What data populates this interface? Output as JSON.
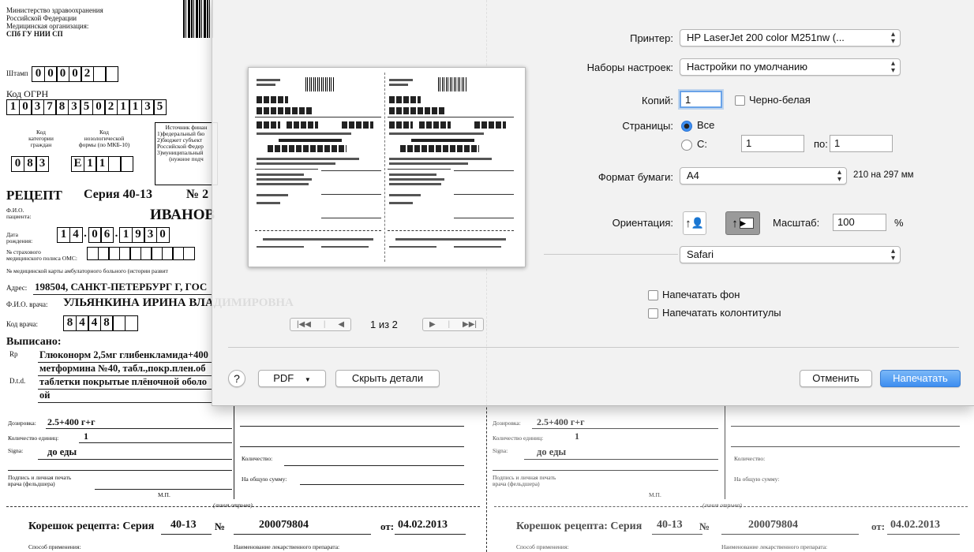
{
  "doc": {
    "ministry": [
      "Министерство здравоохранения",
      "Российской Федерации",
      "Медицинская организация:",
      "СПб ГУ НИИ СП"
    ],
    "stamp_label": "Штамп",
    "stamp_digits": [
      "0",
      "0",
      "0",
      "0",
      "2",
      "",
      ""
    ],
    "ogrn_label": "Код ОГРН",
    "ogrn_digits": [
      "1",
      "0",
      "3",
      "7",
      "8",
      "3",
      "5",
      "0",
      "2",
      "1",
      "1",
      "3",
      "5"
    ],
    "source_lines": [
      "Источник финан",
      "1)федеральный бю",
      "2)бюджет субъект",
      "Российской Федер",
      "3)муниципальный",
      "(нужное подч"
    ],
    "cat_label": [
      "Код",
      "категории",
      "граждан"
    ],
    "cat_digits": [
      "0",
      "8",
      "3"
    ],
    "nos_label": [
      "Код",
      "нозологической",
      "формы (по МКБ-10)"
    ],
    "nos_digits": [
      "Е",
      "1",
      "1",
      "",
      ""
    ],
    "recipe_title": "РЕЦЕПТ",
    "series_label": "Серия 40-13",
    "number_label": "№ 2",
    "fio_label": [
      "Ф.И.О.",
      "пациента:"
    ],
    "patient_name": "ИВАНОВ",
    "dob_label": [
      "Дата",
      "рождения:"
    ],
    "dob_digits": [
      "1",
      "4",
      ".",
      "0",
      "6",
      ".",
      "1",
      "9",
      "3",
      "0"
    ],
    "polis_label": [
      "№ страхового",
      "медицинского полиса ОМС:"
    ],
    "card_label": "№ медицинской карты амбулаторного больного (истории развит",
    "address_label": "Адрес:",
    "address": "198504, САНКТ-ПЕТЕРБУРГ Г, ГОС",
    "doctor_label": "Ф.И.О. врача:",
    "doctor_name": "УЛЬЯНКИНА ИРИНА ВЛАДИМИРОВНА",
    "doctor_code_label": "Код врача:",
    "doctor_code_digits": [
      "8",
      "4",
      "4",
      "8",
      "",
      ""
    ],
    "prescribed_label": "Выписано:",
    "rp_label": "Rp",
    "dtd_label": "D.t.d.",
    "drug_lines": [
      "Глюконорм 2,5мг глибенкламида+400",
      "метформина №40, табл.,покр.плен.об",
      "таблетки покрытые плёночной оболо",
      "ой"
    ],
    "dosage_label": "Дозировка:",
    "dosage": "2.5+400 г+г",
    "units_label": "Количество единиц:",
    "units": "1",
    "signa_label": "Signa:",
    "signa": "до еды",
    "quantity_label": "Количество:",
    "total_label": "На общую сумму:",
    "sign_label": [
      "Подпись и личная печать",
      "врача (фельдшера)"
    ],
    "mp_label": "М.П.",
    "cutline_label": "(линия отрыва)",
    "stub_label": "Корешок рецепта: Серия",
    "stub_series": "40-13",
    "stub_no_label": "№",
    "stub_number": "200079804",
    "stub_date_label": "от:",
    "stub_date": "04.02.2013",
    "method_label": "Способ применения:",
    "drug_name_label": "Наименование лекарственного препарата:"
  },
  "dialog": {
    "printer_label": "Принтер:",
    "printer_value": "HP LaserJet 200 color M251nw (...",
    "presets_label": "Наборы настроек:",
    "presets_value": "Настройки по умолчанию",
    "copies_label": "Копий:",
    "copies_value": "1",
    "bw_label": "Черно-белая",
    "pages_label": "Страницы:",
    "pages_all": "Все",
    "pages_from_label": "С:",
    "pages_from_value": "1",
    "pages_to_label": "по:",
    "pages_to_value": "1",
    "paper_label": "Формат бумаги:",
    "paper_value": "А4",
    "paper_size": "210 на 297 мм",
    "orientation_label": "Ориентация:",
    "scale_label": "Масштаб:",
    "scale_value": "100",
    "scale_unit": "%",
    "app_value": "Safari",
    "print_bg_label": "Напечатать фон",
    "print_headers_label": "Напечатать колонтитулы",
    "page_counter": "1 из 2",
    "help_label": "?",
    "pdf_label": "PDF",
    "hide_details_label": "Скрыть детали",
    "cancel_label": "Отменить",
    "print_label": "Напечатать",
    "preview_doc_title": "ИВАНОВА МАРИЯ АКИМОВНА",
    "preview_doc_recipe": "РЕЦЕПТ Серия 40-13 № 200079804"
  },
  "icons": {
    "first": "first-page-icon",
    "prev": "prev-page-icon",
    "next": "next-page-icon",
    "last": "last-page-icon",
    "portrait": "portrait-orientation-icon",
    "landscape": "landscape-orientation-icon"
  },
  "colors": {
    "accent": "#3d8ef0",
    "focus": "#6aa3e8"
  }
}
